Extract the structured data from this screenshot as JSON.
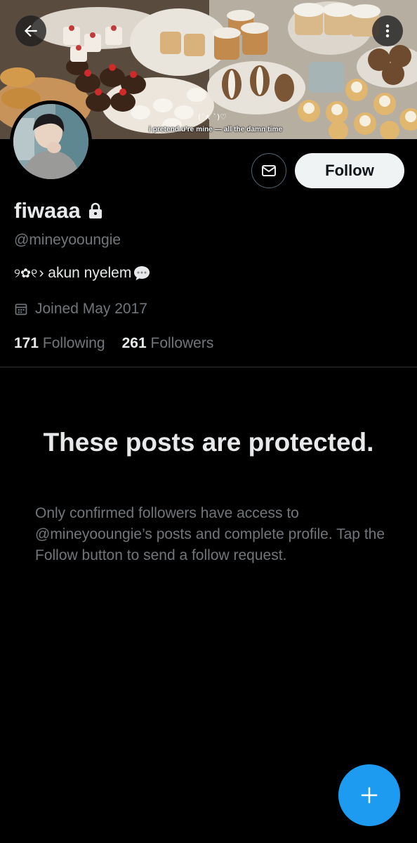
{
  "banner": {
    "caption_symbols": "(´∧ `)♡",
    "caption": "i pretend u're mine — all the damn time"
  },
  "icons": {
    "back": "arrow-left-icon",
    "more": "more-vertical-icon",
    "message": "envelope-icon",
    "lock": "lock-icon",
    "calendar": "calendar-icon",
    "compose": "plus-icon"
  },
  "actions": {
    "follow_label": "Follow"
  },
  "profile": {
    "name": "fiwaaa",
    "handle": "@mineyooungie",
    "bio_emoji": "୨✿୧",
    "bio_text": "› akun nyelem",
    "joined": "Joined May 2017",
    "following_count": "171",
    "following_label": "Following",
    "followers_count": "261",
    "followers_label": "Followers"
  },
  "protected": {
    "title": "These posts are protected.",
    "body": "Only confirmed followers have access to @mineyooungie’s posts and complete profile. Tap the Follow button to send a follow request."
  },
  "colors": {
    "background": "#000000",
    "text_primary": "#e7e9ea",
    "text_secondary": "#71767b",
    "follow_bg": "#eff3f4",
    "fab": "#1d9bf0",
    "divider": "#2f3336"
  }
}
